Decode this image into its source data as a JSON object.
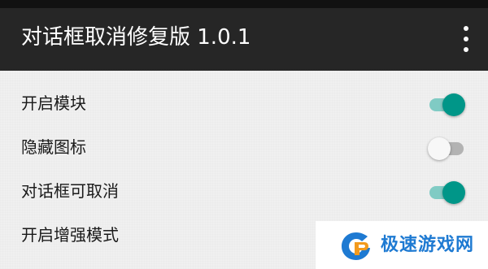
{
  "app": {
    "title": "对话框取消修复版 1.0.1",
    "overflow_icon": "more-vert-icon"
  },
  "colors": {
    "toolbar_bg": "#262626",
    "accent": "#009688",
    "accent_track": "#80cbc4",
    "off_track": "#b3b3b3"
  },
  "settings": [
    {
      "label": "开启模块",
      "enabled": true
    },
    {
      "label": "隐藏图标",
      "enabled": false
    },
    {
      "label": "对话框可取消",
      "enabled": true
    },
    {
      "label": "开启增强模式",
      "enabled": true
    }
  ],
  "watermark": {
    "text": "极速游戏网",
    "icon": "site-logo-icon"
  }
}
